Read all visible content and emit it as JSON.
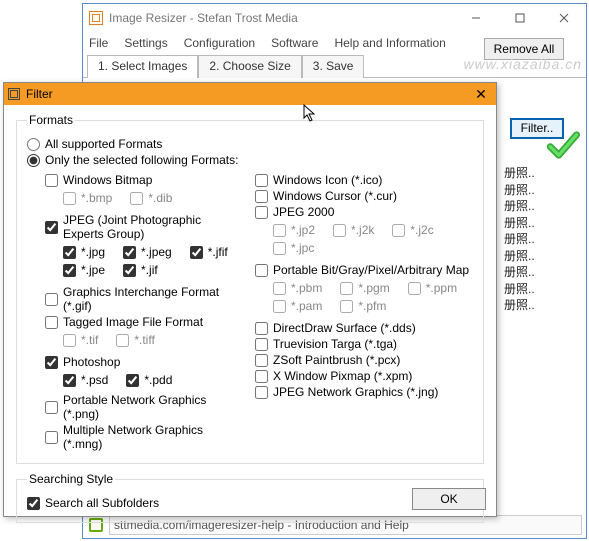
{
  "mainwin": {
    "title": "Image Resizer - Stefan Trost Media",
    "menu": [
      "File",
      "Settings",
      "Configuration",
      "Software",
      "Help and Information"
    ],
    "tabs": [
      "1. Select Images",
      "2. Choose Size",
      "3. Save"
    ],
    "filter_btn": "Filter..",
    "files": [
      "册照..",
      "册照..",
      "册照..",
      "册照..",
      "册照..",
      "册照..",
      "册照..",
      "册照..",
      "册照.."
    ],
    "remove_all": "Remove All",
    "help_text": "sttmedia.com/imageresizer-help - Introduction and Help",
    "watermark": "www.xiazaiba.cn"
  },
  "dialog": {
    "title": "Filter",
    "formats_legend": "Formats",
    "radio_all": "All supported Formats",
    "radio_selected": "Only the selected following Formats:",
    "left": {
      "winbmp": "Windows Bitmap",
      "bmp": "*.bmp",
      "dib": "*.dib",
      "jpeg_group": "JPEG (Joint Photographic Experts Group)",
      "jpg": "*.jpg",
      "jpeg": "*.jpeg",
      "jfif": "*.jfif",
      "jpe": "*.jpe",
      "jif": "*.jif",
      "gif": "Graphics Interchange Format (*.gif)",
      "tiff_group": "Tagged Image File Format",
      "tif": "*.tif",
      "tiff": "*.tiff",
      "photoshop": "Photoshop",
      "psd": "*.psd",
      "pdd": "*.pdd",
      "png": "Portable Network Graphics (*.png)",
      "mng": "Multiple Network Graphics (*.mng)"
    },
    "right": {
      "ico": "Windows Icon (*.ico)",
      "cur": "Windows Cursor (*.cur)",
      "jpeg2000": "JPEG 2000",
      "jp2": "*.jp2",
      "j2k": "*.j2k",
      "j2c": "*.j2c",
      "jpc": "*.jpc",
      "portable_map": "Portable Bit/Gray/Pixel/Arbitrary Map",
      "pbm": "*.pbm",
      "pgm": "*.pgm",
      "ppm": "*.ppm",
      "pam": "*.pam",
      "pfm": "*.pfm",
      "dds": "DirectDraw Surface (*.dds)",
      "tga": "Truevision Targa (*.tga)",
      "pcx": "ZSoft Paintbrush (*.pcx)",
      "xpm": "X Window Pixmap (*.xpm)",
      "jng": "JPEG Network Graphics (*.jng)"
    },
    "search_legend": "Searching Style",
    "search_sub": "Search all Subfolders",
    "ok": "OK"
  }
}
